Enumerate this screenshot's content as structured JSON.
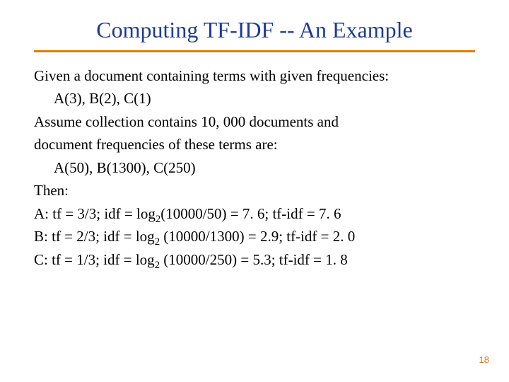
{
  "title": "Computing TF-IDF -- An Example",
  "body": {
    "line1": "Given a document containing terms with given frequencies:",
    "line2": "A(3), B(2), C(1)",
    "line3": "Assume collection contains 10, 000 documents and",
    "line4": "document frequencies of these terms are:",
    "line5": "A(50), B(1300), C(250)",
    "line6": "Then:",
    "row_a": {
      "label": "A:  tf = 3/3;  idf = log",
      "sub": "2",
      "rest": "(10000/50) = 7. 6;     tf-idf = 7. 6"
    },
    "row_b": {
      "label": "B:  tf = 2/3;  idf = log",
      "sub": "2",
      "rest": " (10000/1300) = 2.9; tf-idf = 2. 0"
    },
    "row_c": {
      "label": "C:  tf = 1/3;  idf = log",
      "sub": "2",
      "rest": " (10000/250) = 5.3;  tf-idf = 1. 8"
    }
  },
  "page_number": "18"
}
